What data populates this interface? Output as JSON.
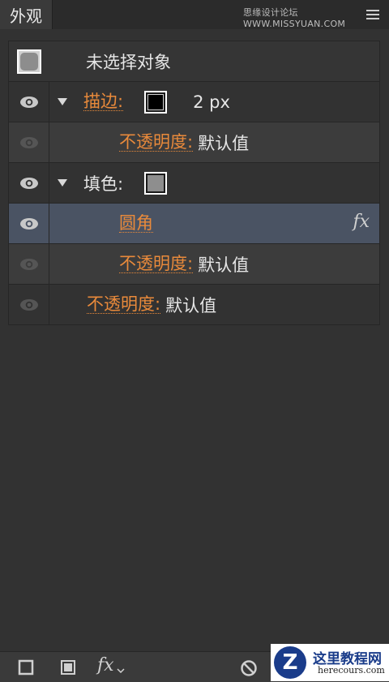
{
  "tab": {
    "label": "外观"
  },
  "watermark": "思缘设计论坛 WWW.MISSYUAN.COM",
  "rows": {
    "header": {
      "label": "未选择对象"
    },
    "stroke": {
      "label": "描边:",
      "value": "2 px"
    },
    "stroke_opacity": {
      "label": "不透明度:",
      "value": "默认值"
    },
    "fill": {
      "label": "填色:"
    },
    "round_corners": {
      "label": "圆角",
      "fx": "fx"
    },
    "fill_opacity": {
      "label": "不透明度:",
      "value": "默认值"
    },
    "opacity": {
      "label": "不透明度:",
      "value": "默认值"
    }
  },
  "bottom": {
    "fx_label": "fx"
  },
  "logo": {
    "letter": "Z",
    "title": "这里教程网",
    "url": "herecours.com"
  },
  "colors": {
    "accent": "#e98a3b",
    "selected_row": "#4a5363",
    "panel": "#323232"
  },
  "icons": [
    "panel-menu-icon",
    "eye-icon",
    "disclosure-triangle-icon",
    "fx-icon",
    "new-stroke-icon",
    "new-fill-icon",
    "clear-icon"
  ]
}
